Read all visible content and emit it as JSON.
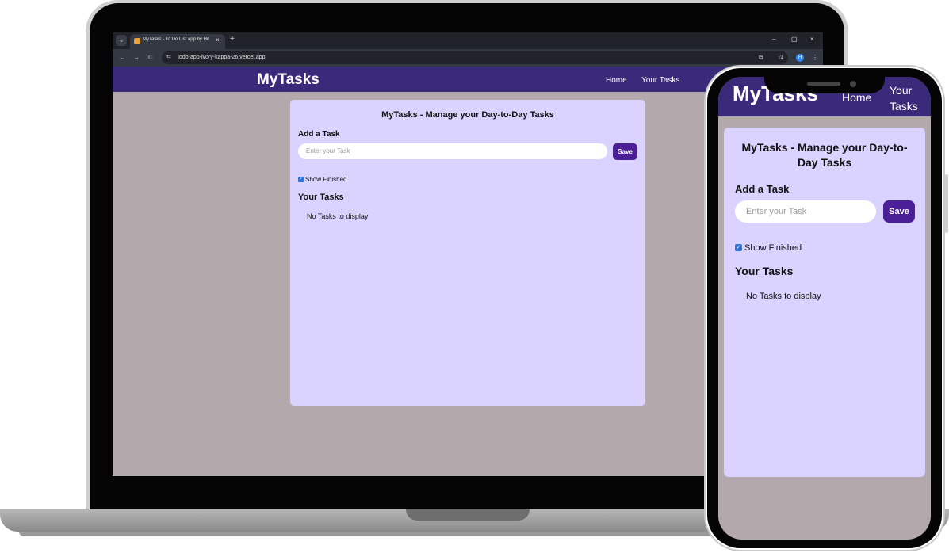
{
  "browser": {
    "tab_title": "MyTasks - To Do List app by Hit",
    "tab_close": "×",
    "new_tab": "+",
    "menu": "⌄",
    "win_min": "–",
    "win_max": "▢",
    "win_close": "×",
    "back": "←",
    "forward": "→",
    "reload": "C",
    "site_info": "⇆",
    "url": "todo-app-ivory-kappa-26.vercel.app",
    "star": "☆",
    "extensions": "⧉",
    "download": "⤓",
    "profile_initial": "H",
    "more": "⋮"
  },
  "app": {
    "brand": "MyTasks",
    "nav": {
      "home": "Home",
      "your_tasks": "Your Tasks"
    },
    "card_title": "MyTasks - Manage your Day-to-Day Tasks",
    "add_label": "Add a Task",
    "input_placeholder": "Enter your Task",
    "save_label": "Save",
    "show_finished_label": "Show Finished",
    "show_finished_checked": true,
    "check_mark": "✓",
    "tasks_heading": "Your Tasks",
    "empty_text": "No Tasks to display"
  },
  "colors": {
    "navbar": "#3a2a7a",
    "card": "#dbd3ff",
    "page_bg": "#b3a9ad",
    "save_button": "#4b1f96",
    "checkbox": "#2f74d8"
  }
}
